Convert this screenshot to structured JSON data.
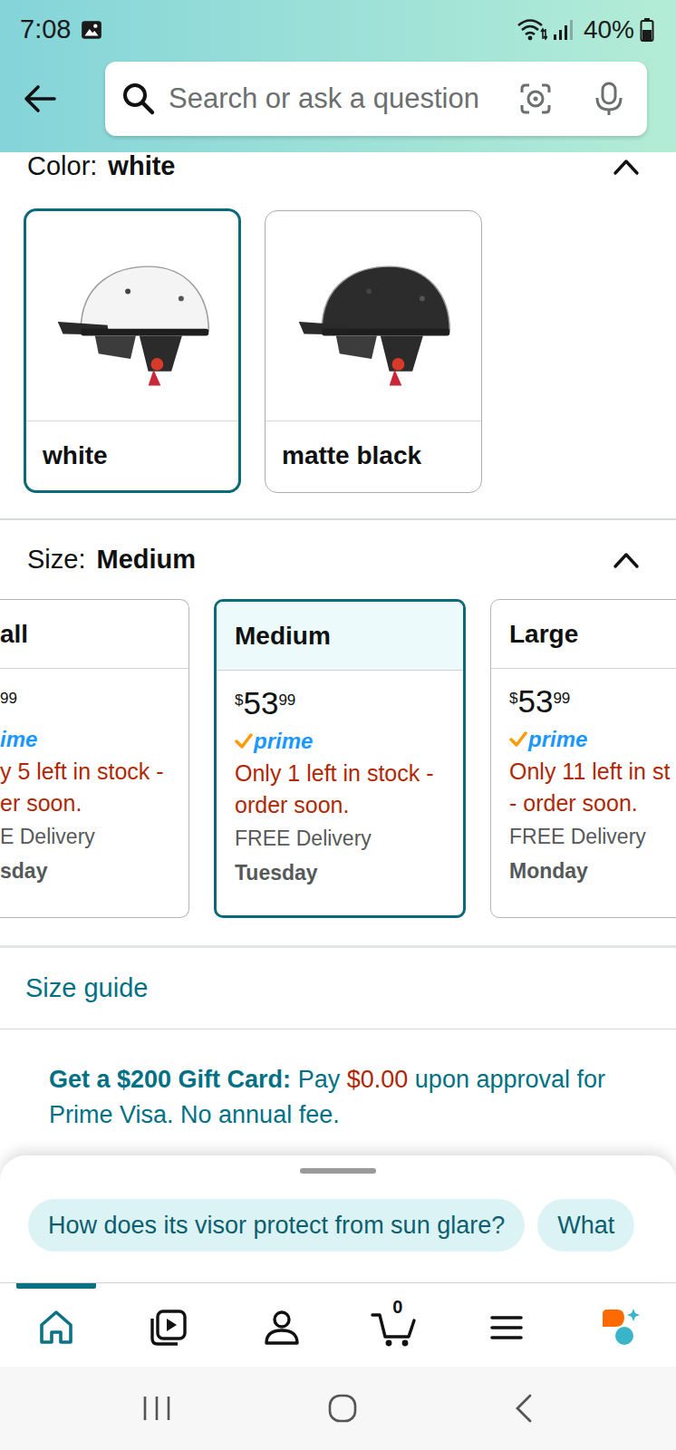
{
  "status_bar": {
    "time": "7:08",
    "battery": "40%"
  },
  "search": {
    "placeholder": "Search or ask a question"
  },
  "color_section": {
    "label": "Color:",
    "value": "white",
    "expanded": true,
    "options": [
      {
        "label": "white",
        "selected": true,
        "color": "#f4f4f4"
      },
      {
        "label": "matte black",
        "selected": false,
        "color": "#2c2c2c"
      }
    ]
  },
  "size_section": {
    "label": "Size:",
    "value": "Medium",
    "expanded": true,
    "options": [
      {
        "kind": "clipped",
        "label": "all",
        "price": {
          "fraction": "99"
        },
        "prime": "ime",
        "stock": [
          "y 5 left in stock -",
          "er soon."
        ],
        "delivery": "E Delivery",
        "day": "sday",
        "selected": false
      },
      {
        "kind": "full",
        "label": "Medium",
        "price": {
          "symbol": "$",
          "whole": "53",
          "fraction": "99"
        },
        "prime": "prime",
        "stock": [
          "Only 1 left in stock -",
          "order soon."
        ],
        "delivery": "FREE Delivery",
        "day": "Tuesday",
        "selected": true
      },
      {
        "kind": "full",
        "label": "Large",
        "price": {
          "symbol": "$",
          "whole": "53",
          "fraction": "99"
        },
        "prime": "prime",
        "stock": [
          "Only 11 left in st",
          "- order soon."
        ],
        "delivery": "FREE Delivery",
        "day": "Monday",
        "selected": false
      }
    ]
  },
  "size_guide": "Size guide",
  "promo": {
    "title": "Get a $200 Gift Card:",
    "pre": "Pay",
    "amount": "$0.00",
    "post": "upon approval for Prime Visa. No annual fee."
  },
  "suggestions": [
    {
      "label": "How does its visor protect from sun glare?"
    },
    {
      "label": "What"
    }
  ],
  "nav": {
    "items": [
      {
        "kind": "home",
        "selected": true
      },
      {
        "kind": "video",
        "selected": false
      },
      {
        "kind": "account",
        "selected": false
      },
      {
        "kind": "cart",
        "selected": false,
        "badge": "0"
      },
      {
        "kind": "menu",
        "selected": false
      },
      {
        "kind": "assistant",
        "selected": false
      }
    ]
  }
}
